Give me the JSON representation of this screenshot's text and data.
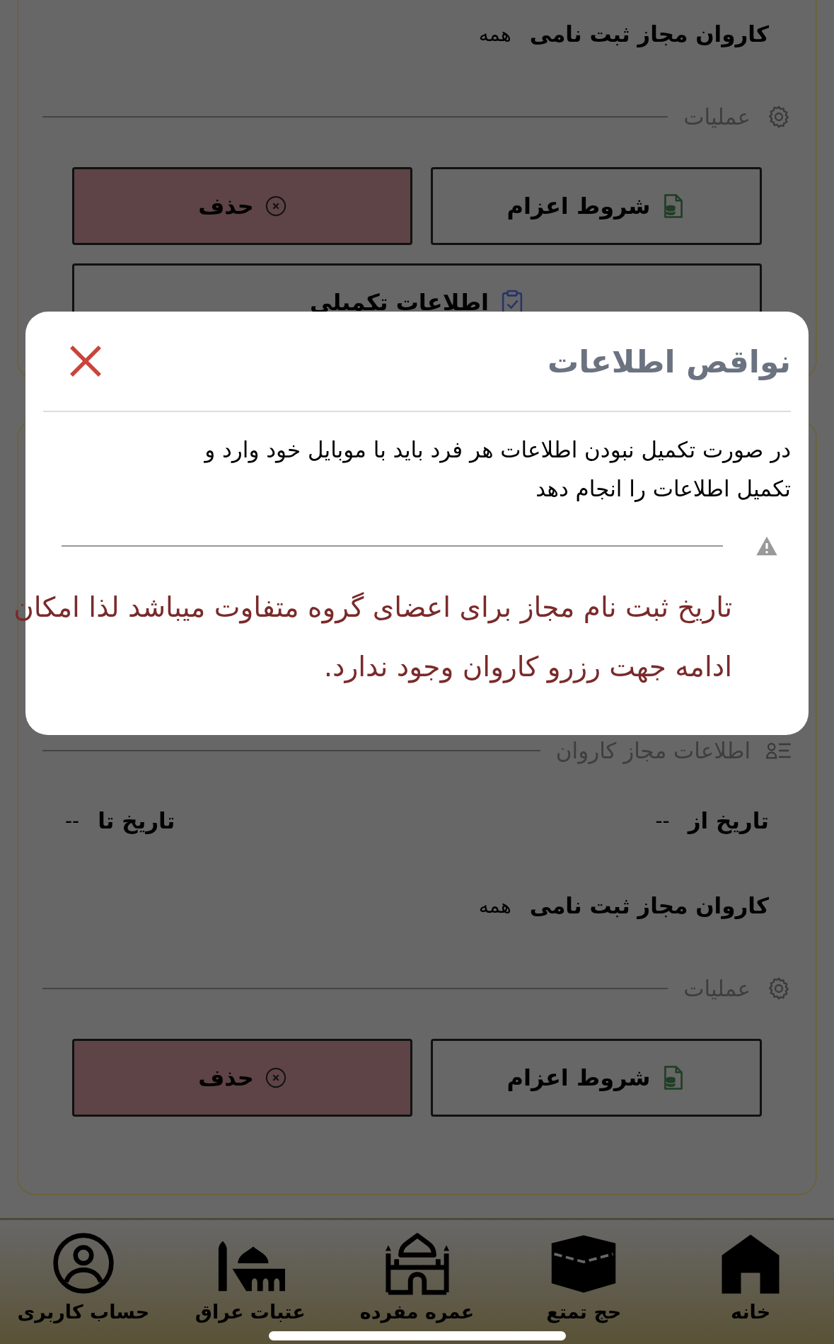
{
  "cards": [
    {
      "kind": "upper",
      "sections": [
        {
          "kind": "fields",
          "fields": [
            {
              "label": "کاروان مجاز ثبت نامی",
              "value": "همه"
            }
          ]
        },
        {
          "kind": "ops-heading",
          "title": "عملیات"
        },
        {
          "kind": "buttons",
          "buttons": [
            {
              "label": "شروط اعزام",
              "kind": "terms"
            },
            {
              "label": "حذف",
              "kind": "delete"
            }
          ]
        },
        {
          "kind": "buttons",
          "buttons": [
            {
              "label": "اطلاعات تکمیلی",
              "kind": "details"
            }
          ]
        }
      ]
    },
    {
      "kind": "lower",
      "sections": [
        {
          "kind": "info-heading",
          "title": "اطلاعات مجاز کاروان"
        },
        {
          "kind": "fields",
          "fields": [
            {
              "label": "تاریخ از",
              "value": "--"
            },
            {
              "label": "تاریخ تا",
              "value": "--"
            }
          ]
        },
        {
          "kind": "fields",
          "fields": [
            {
              "label": "کاروان مجاز ثبت نامی",
              "value": "همه"
            }
          ]
        },
        {
          "kind": "ops-heading",
          "title": "عملیات"
        },
        {
          "kind": "buttons",
          "buttons": [
            {
              "label": "شروط اعزام",
              "kind": "terms"
            },
            {
              "label": "حذف",
              "kind": "delete"
            }
          ]
        }
      ]
    }
  ],
  "modal": {
    "title": "نواقص اطلاعات",
    "message": "در صورت تکمیل نبودن اطلاعات هر فرد باید با موبایل خود وارد و تکمیل اطلاعات را انجام دهد",
    "warning": "تاریخ ثبت نام مجاز برای اعضای گروه متفاوت میباشد لذا امکان ادامه جهت رزرو کاروان وجود ندارد."
  },
  "nav": [
    {
      "label": "خانه"
    },
    {
      "label": "حج تمتع"
    },
    {
      "label": "عمره مفرده"
    },
    {
      "label": "عتبات عراق"
    },
    {
      "label": "حساب کاربری"
    }
  ]
}
